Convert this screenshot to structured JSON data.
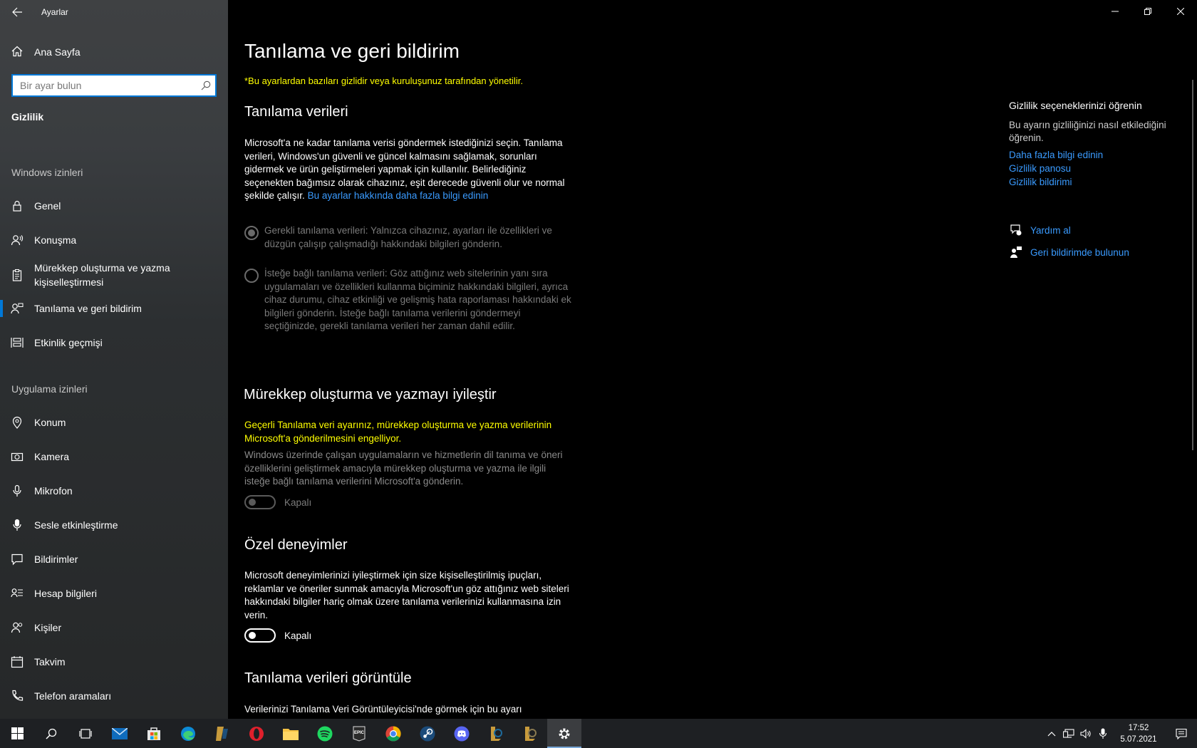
{
  "window": {
    "app_title": "Ayarlar"
  },
  "sidebar": {
    "home_label": "Ana Sayfa",
    "search_placeholder": "Bir ayar bulun",
    "current_section": "Gizlilik",
    "windows_group": "Windows izinleri",
    "windows_items": [
      {
        "label": "Genel",
        "icon": "lock-icon"
      },
      {
        "label": "Konuşma",
        "icon": "speech-icon"
      },
      {
        "label": "Mürekkep oluşturma ve yazma kişiselleştirmesi",
        "icon": "clipboard-icon"
      },
      {
        "label": "Tanılama ve geri bildirim",
        "icon": "feedback-person-icon",
        "selected": true
      },
      {
        "label": "Etkinlik geçmişi",
        "icon": "timeline-icon"
      }
    ],
    "app_group": "Uygulama izinleri",
    "app_items": [
      {
        "label": "Konum",
        "icon": "location-icon"
      },
      {
        "label": "Kamera",
        "icon": "camera-icon"
      },
      {
        "label": "Mikrofon",
        "icon": "microphone-icon"
      },
      {
        "label": "Sesle etkinleştirme",
        "icon": "voice-activation-icon"
      },
      {
        "label": "Bildirimler",
        "icon": "notification-icon"
      },
      {
        "label": "Hesap bilgileri",
        "icon": "account-info-icon"
      },
      {
        "label": "Kişiler",
        "icon": "contacts-icon"
      },
      {
        "label": "Takvim",
        "icon": "calendar-icon"
      },
      {
        "label": "Telefon aramaları",
        "icon": "phone-icon"
      }
    ]
  },
  "main": {
    "title": "Tanılama ve geri bildirim",
    "managed_note": "*Bu ayarlardan bazıları gizlidir veya kuruluşunuz tarafından yönetilir.",
    "diag": {
      "heading": "Tanılama verileri",
      "description": "Microsoft'a ne kadar tanılama verisi göndermek istediğinizi seçin. Tanılama verileri, Windows'un güvenli ve güncel kalmasını sağlamak, sorunları gidermek ve ürün geliştirmeleri yapmak için kullanılır. Belirlediğiniz seçenekten bağımsız olarak cihazınız, eşit derecede güvenli olur ve normal şekilde çalışır.",
      "learn_more_link": "Bu ayarlar hakkında daha fazla bilgi edinin",
      "option_required": "Gerekli tanılama verileri: Yalnızca cihazınız, ayarları ile özellikleri ve düzgün çalışıp çalışmadığı hakkındaki bilgileri gönderin.",
      "option_optional": "İsteğe bağlı tanılama verileri: Göz attığınız web sitelerinin yanı sıra uygulamaları ve özellikleri kullanma biçiminiz hakkındaki bilgileri, ayrıca cihaz durumu, cihaz etkinliği ve gelişmiş hata raporlaması hakkındaki ek bilgileri gönderin. İsteğe bağlı tanılama verilerini göndermeyi seçtiğinizde, gerekli tanılama verileri her zaman dahil edilir."
    },
    "ink": {
      "heading": "Mürekkep oluşturma ve yazmayı iyileştir",
      "warning": "Geçerli Tanılama veri ayarınız, mürekkep oluşturma ve yazma verilerinin Microsoft'a gönderilmesini engelliyor.",
      "description": "Windows üzerinde çalışan uygulamaların ve hizmetlerin dil tanıma ve öneri özelliklerini geliştirmek amacıyla mürekkep oluşturma ve yazma ile ilgili isteğe bağlı tanılama verilerini Microsoft'a gönderin.",
      "toggle_label": "Kapalı"
    },
    "tailored": {
      "heading": "Özel deneyimler",
      "description": "Microsoft deneyimlerinizi iyileştirmek için size kişiselleştirilmiş ipuçları, reklamlar ve öneriler sunmak amacıyla Microsoft'un göz attığınız web siteleri hakkındaki bilgiler hariç olmak üzere tanılama verilerinizi kullanmasına izin verin.",
      "toggle_label": "Kapalı"
    },
    "viewer": {
      "heading": "Tanılama verileri görüntüle",
      "description": "Verilerinizi Tanılama Veri Görüntüleyicisi'nde görmek için bu ayarı"
    }
  },
  "right": {
    "heading": "Gizlilik seçeneklerinizi öğrenin",
    "description": "Bu ayarın gizliliğinizi nasıl etkilediğini öğrenin.",
    "links": [
      "Daha fazla bilgi edinin",
      "Gizlilik panosu",
      "Gizlilik bildirimi"
    ],
    "help_label": "Yardım al",
    "feedback_label": "Geri bildirimde bulunun"
  },
  "taskbar": {
    "apps": [
      "start-icon",
      "search-icon",
      "task-view-icon",
      "mail-icon",
      "store-icon",
      "edge-icon",
      "game-launcher-icon",
      "opera-icon",
      "file-explorer-icon",
      "spotify-icon",
      "epic-games-icon",
      "chrome-icon",
      "steam-icon",
      "discord-icon",
      "league-icon",
      "league-client-icon",
      "settings-icon"
    ],
    "epic_text": "EPIC",
    "time": "17:52",
    "date": "5.07.2021"
  },
  "colors": {
    "accent": "#0078d7",
    "link": "#3a9bff",
    "warning": "#ffff00"
  }
}
